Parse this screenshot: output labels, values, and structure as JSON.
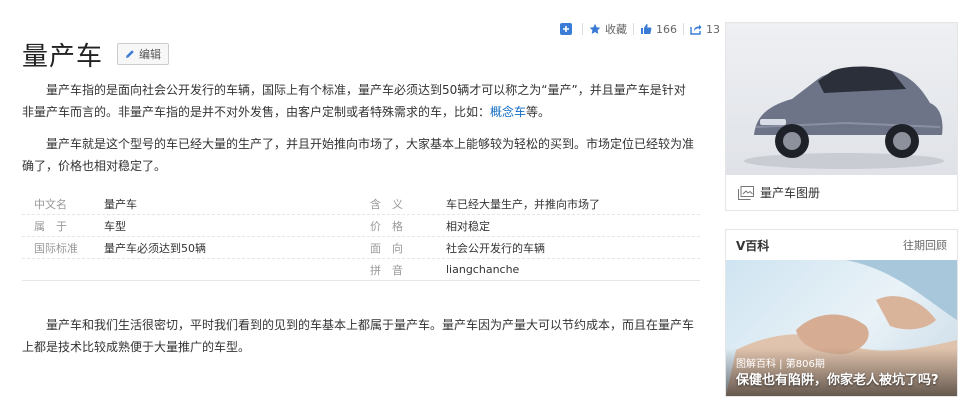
{
  "actions": {
    "add_icon": "plus-square-icon",
    "favorite_icon": "star-icon",
    "favorite_label": "收藏",
    "like_icon": "thumbs-up-icon",
    "like_count": "166",
    "share_icon": "share-icon",
    "share_count": "13"
  },
  "header": {
    "title": "量产车",
    "edit_label": "编辑"
  },
  "content": {
    "p1_text": "量产车指的是面向社会公开发行的车辆，国际上有个标准，量产车必须达到50辆才可以称之为“量产”，并且量产车是针对非量产车而言的。非量产车指的是并不对外发售，由客户定制或者特殊需求的车，比如：",
    "p1_link": "概念车",
    "p1_tail": "等。",
    "p2_text": "量产车就是这个型号的车已经大量的生产了，并且开始推向市场了，大家基本上能够较为轻松的买到。市场定位已经较为准确了，价格也相对稳定了。",
    "p3_text": "量产车和我们生活很密切，平时我们看到的见到的车基本上都属于量产车。量产车因为产量大可以节约成本，而且在量产车上都是技术比较成熟便于大量推广的车型。"
  },
  "infobox": {
    "rows": [
      {
        "k1": "中文名",
        "v1": "量产车",
        "k2": "含　义",
        "v2": "车已经大量生产，并推向市场了"
      },
      {
        "k1": "属　于",
        "v1": "车型",
        "k2": "价　格",
        "v2": "相对稳定"
      },
      {
        "k1": "国际标准",
        "v1": "量产车必须达到50辆",
        "k2": "面　向",
        "v2": "社会公开发行的车辆"
      },
      {
        "k1": "",
        "v1": "",
        "k2": "拼　音",
        "v2": "liangchanche"
      }
    ]
  },
  "sidebar": {
    "album_caption": "量产车图册",
    "album_icon": "image-gallery-icon",
    "vbox_title": "V百科",
    "vbox_more": "往期回顾",
    "vbox_tag": "图解百科 | 第806期",
    "vbox_caption": "保健也有陷阱，你家老人被坑了吗?"
  },
  "colors": {
    "link": "#136ec2",
    "icon_blue": "#3a7bd5"
  }
}
